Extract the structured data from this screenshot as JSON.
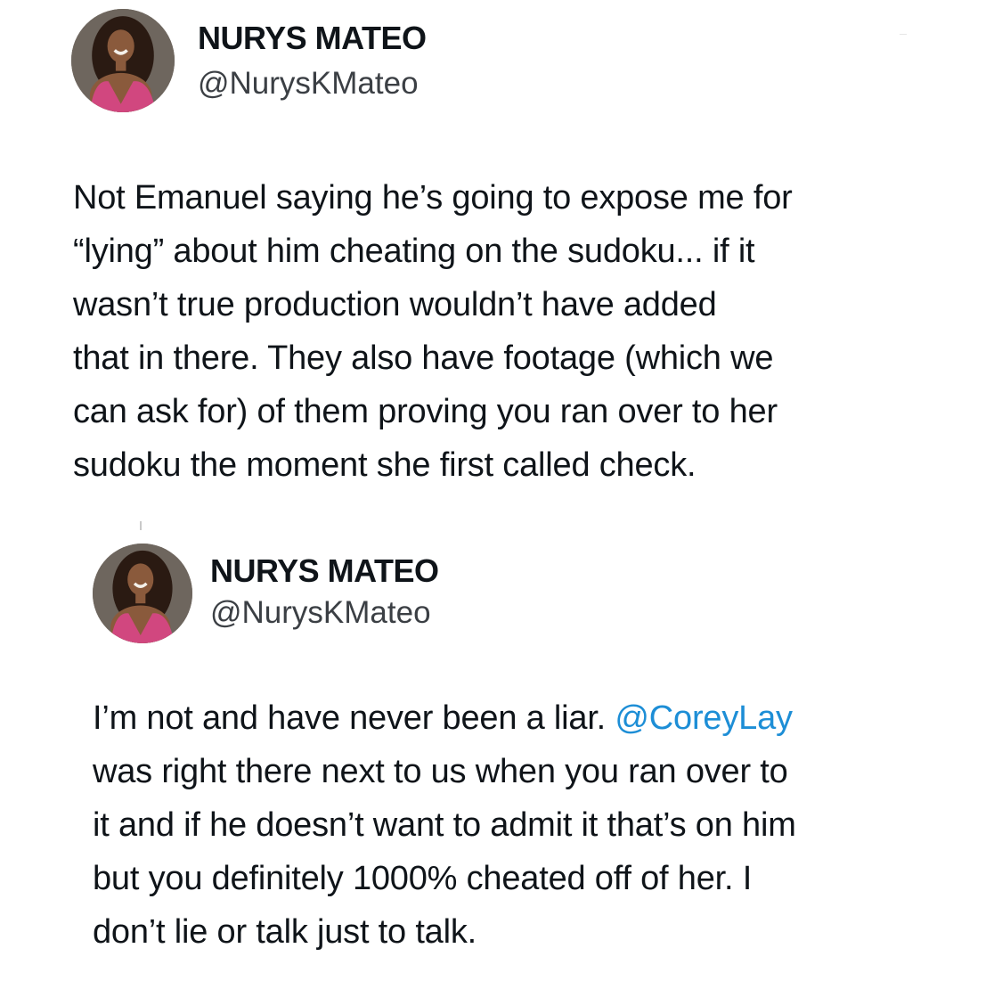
{
  "tweets": [
    {
      "author": {
        "name": "NURYS MATEO",
        "handle": "@NurysKMateo"
      },
      "lines": [
        "Not Emanuel saying he’s going to expose me for",
        "“lying” about him cheating on the sudoku... if it",
        "wasn’t true production wouldn’t have added",
        "that in there. They also have footage (which we",
        "can ask for) of them proving you ran over to her",
        "sudoku the moment she first called check."
      ]
    },
    {
      "author": {
        "name": "NURYS MATEO",
        "handle": "@NurysKMateo"
      },
      "line1_before": "I’m not and have never been a liar. ",
      "mention": "@CoreyLay",
      "lines_after": [
        "was right there next to us when you ran over to",
        "it and if he doesn’t want to admit it that’s on him",
        "but you definitely 1000% cheated off of her. I",
        "don’t lie or talk just to talk."
      ]
    }
  ],
  "colors": {
    "text": "#0f1419",
    "handle": "#3b3f44",
    "mention": "#1d8ed6",
    "background": "#ffffff"
  },
  "icons": {
    "avatar": "profile-photo"
  }
}
